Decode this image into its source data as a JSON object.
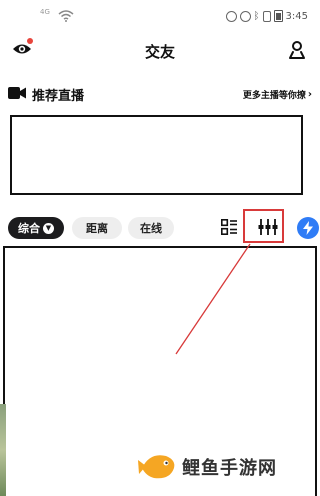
{
  "status_bar": {
    "carrier_small": "4G",
    "battery": "91",
    "time": "3:45"
  },
  "header": {
    "title": "交友"
  },
  "live": {
    "title": "推荐直播",
    "more_link": "更多主播等你撩",
    "more_chevron": "›"
  },
  "filters": {
    "active_label": "综合",
    "distance_label": "距离",
    "online_label": "在线"
  },
  "icons": {
    "left_header": "eye-icon",
    "right_header": "profile-location-icon",
    "live": "video-icon",
    "grid": "grid-list-icon",
    "filter": "filter-sliders-icon",
    "flash": "flash-icon"
  },
  "colors": {
    "accent_blue": "#2f7cf6",
    "annotation_red": "#d83a3a",
    "active_pill": "#1c1c1e"
  },
  "watermark": {
    "text": "鲤鱼手游网"
  }
}
